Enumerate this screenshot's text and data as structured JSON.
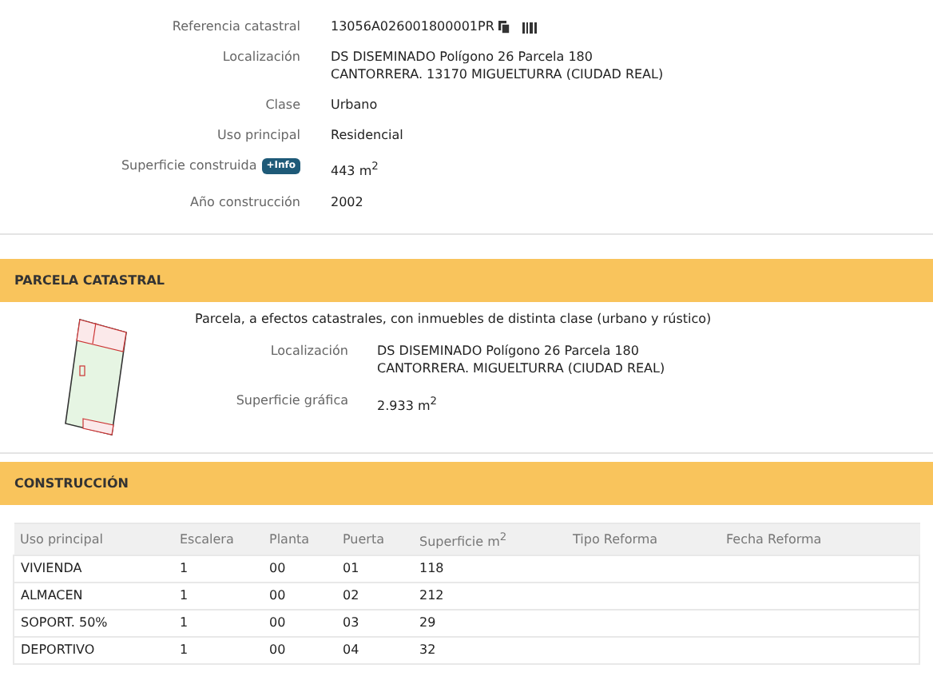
{
  "property": {
    "fields": [
      {
        "label": "Referencia catastral",
        "value": "13056A026001800001PR",
        "kind": "reference"
      },
      {
        "label": "Localización",
        "value": "DS DISEMINADO Polígono 26 Parcela 180",
        "value_line_2": "CANTORRERA. 13170 MIGUELTURRA (CIUDAD REAL)",
        "kind": "text"
      },
      {
        "label": "Clase",
        "value": "Urbano",
        "kind": "text"
      },
      {
        "label": "Uso principal",
        "value": "Residencial",
        "kind": "text"
      },
      {
        "label": "Superficie construida",
        "badge": "+Info",
        "value": "443 m$^{2}$",
        "kind": "text"
      },
      {
        "label": "Año construcción",
        "value": "2002",
        "kind": "text"
      }
    ]
  },
  "parcel": {
    "title": "PARCELA CATASTRAL",
    "description": "Parcela, a efectos catastrales, con inmuebles de distinta clase (urbano y rústico)",
    "fields": [
      {
        "label": "Localización",
        "value": "DS DISEMINADO Polígono 26 Parcela 180",
        "value_line_2": "CANTORRERA. MIGUELTURRA (CIUDAD REAL)"
      },
      {
        "label": "Superficie gráfica",
        "value": "2.933 m$^{2}$"
      }
    ]
  },
  "construction": {
    "title": "CONSTRUCCIÓN",
    "table": {
      "columns": [
        "Uso principal",
        "Escalera",
        "Planta",
        "Puerta",
        "Superficie m$^{2}$",
        "Tipo Reforma",
        "Fecha Reforma"
      ],
      "rows": [
        [
          "VIVIENDA",
          "1",
          "00",
          "01",
          "118"
        ],
        [
          "ALMACEN",
          "1",
          "00",
          "02",
          "212"
        ],
        [
          "SOPORT. 50%",
          "1",
          "00",
          "03",
          "29"
        ],
        [
          "DEPORTIVO",
          "1",
          "00",
          "04",
          "32"
        ]
      ]
    }
  }
}
